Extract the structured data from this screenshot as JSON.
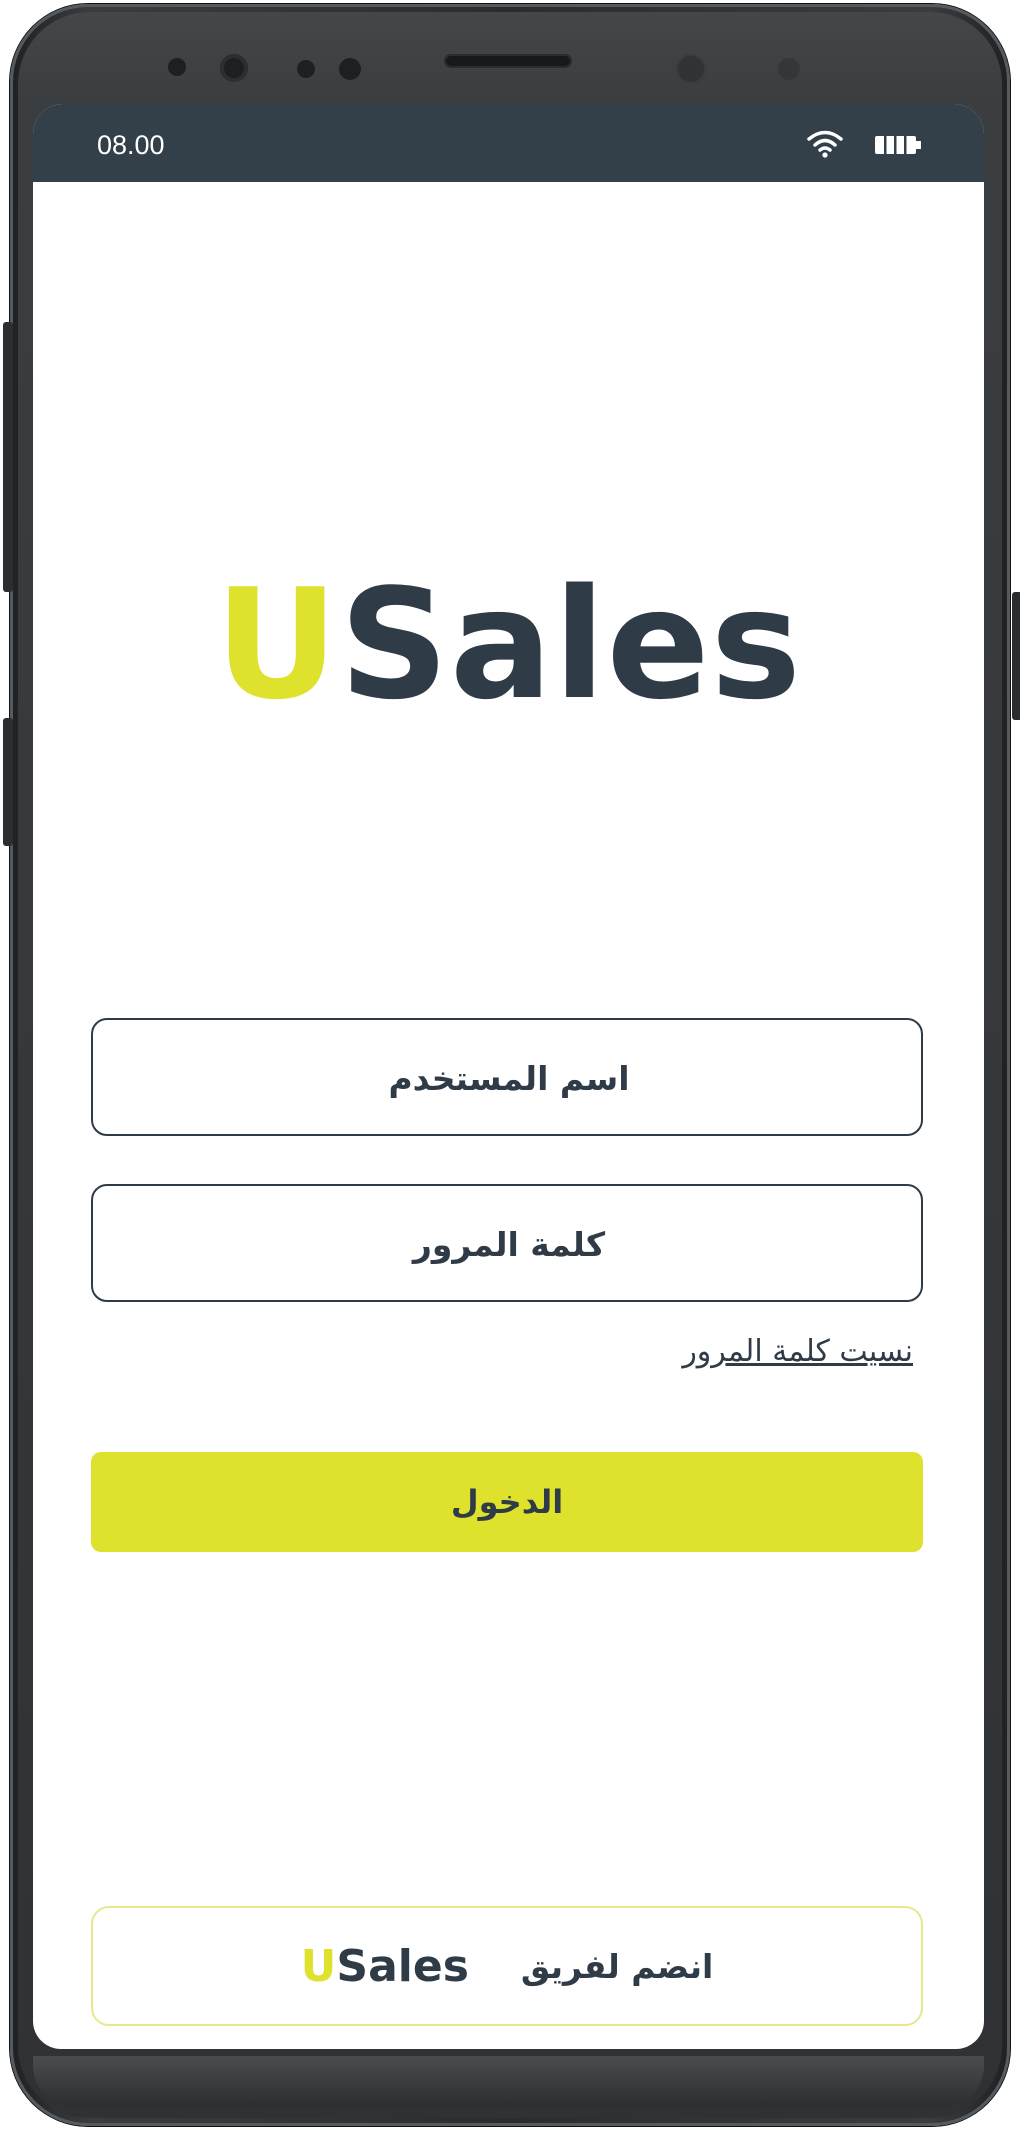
{
  "status_bar": {
    "time": "08.00",
    "wifi_icon": "wifi-icon",
    "battery_icon": "battery-icon",
    "background": "#333f49"
  },
  "logo": {
    "first_letter": "U",
    "rest": "Sales",
    "accent_color": "#dfe22c",
    "text_color": "#2f3b47"
  },
  "form": {
    "username_placeholder": "اسم المستخدم",
    "password_placeholder": "كلمة المرور",
    "forgot_password": "نسيت كلمة المرور",
    "login_label": "الدخول"
  },
  "join": {
    "text": "انضم لفريق",
    "brand_first_letter": "U",
    "brand_rest": "Sales"
  },
  "colors": {
    "accent": "#dfe22c",
    "dark": "#2f3b47"
  }
}
